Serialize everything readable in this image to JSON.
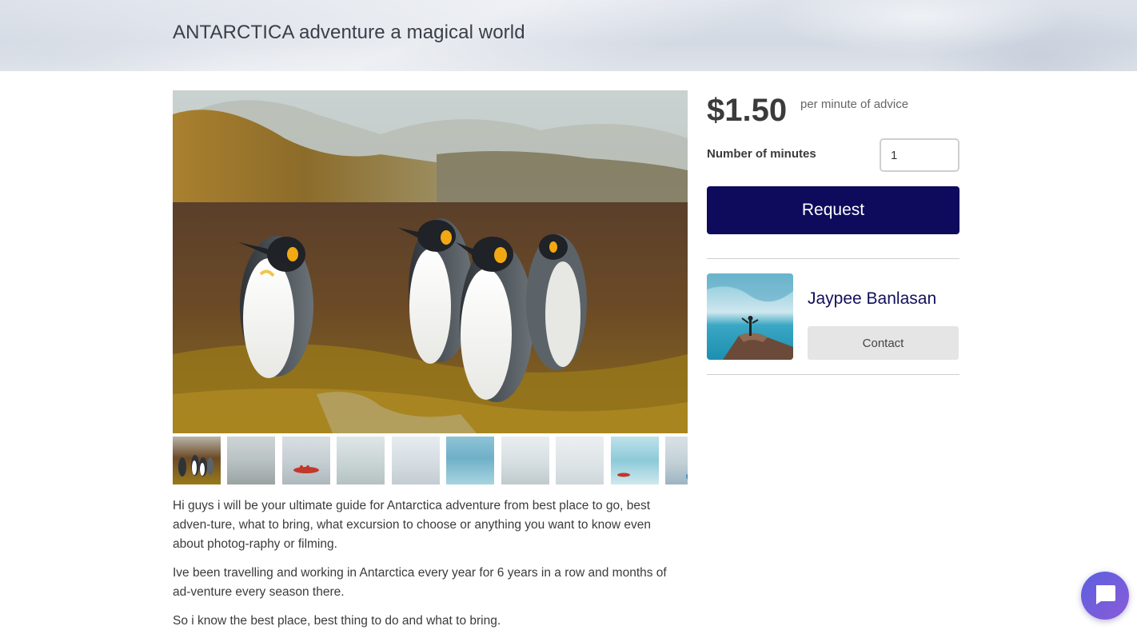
{
  "header": {
    "title": "ANTARCTICA adventure a magical world"
  },
  "gallery": {
    "main_image": "penguins-on-grassland",
    "thumbnails": [
      "penguins-thumbnail",
      "icy-shore-thumbnail",
      "zodiac-boat-thumbnail",
      "snowy-hills-thumbnail",
      "snow-camp-thumbnail",
      "blue-iceberg-thumbnail",
      "glacier-thumbnail",
      "person-in-snow-thumbnail",
      "kayak-thumbnail",
      "kayaker-thumbnail",
      "partial-thumbnail"
    ]
  },
  "description": {
    "paragraphs": [
      "Hi guys i will be your ultimate guide for Antarctica adventure from best place to go, best adven-ture, what to bring, what excursion to choose or anything you want to know even about photog-raphy or filming.",
      "Ive been travelling and working in Antarctica every year for 6 years in a row and months of ad-venture every season there.",
      "So i know the best place, best thing to do and what to bring."
    ]
  },
  "booking": {
    "price": "$1.50",
    "price_note": "per minute of advice",
    "minutes_label": "Number of minutes",
    "minutes_value": "1",
    "request_label": "Request"
  },
  "author": {
    "name": "Jaypee Banlasan",
    "contact_label": "Contact"
  },
  "colors": {
    "primary": "#0e0a5c",
    "author_name": "#12105a",
    "chat_gradient_start": "#5c5fe0",
    "chat_gradient_end": "#8a5cd8"
  },
  "icons": {
    "chat": "chat-bubble-icon"
  }
}
